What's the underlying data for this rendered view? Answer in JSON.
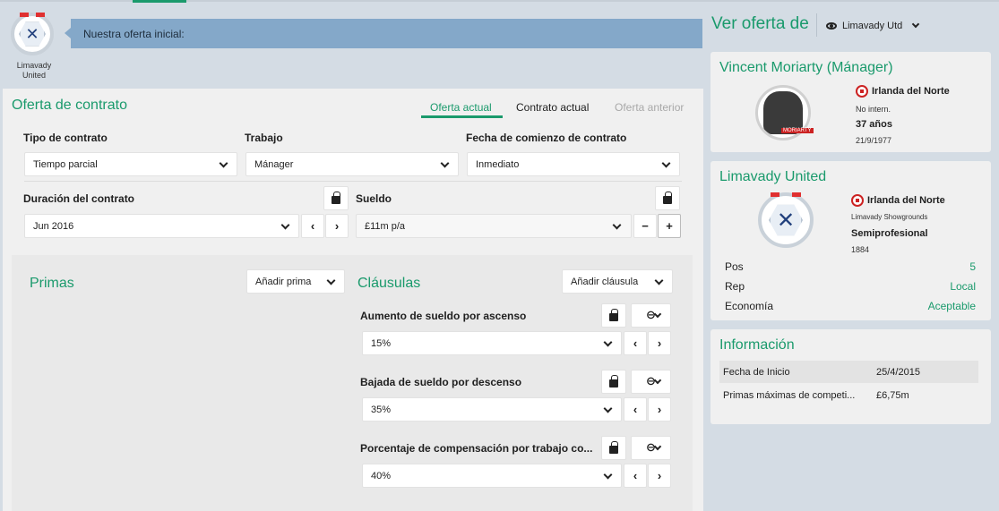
{
  "club_badge": {
    "name_line1": "Limavady",
    "name_line2": "United"
  },
  "message": {
    "text": "Nuestra oferta inicial:"
  },
  "offer": {
    "title": "Oferta de contrato",
    "tabs": [
      "Oferta actual",
      "Contrato actual",
      "Oferta anterior"
    ],
    "fields": {
      "contract_type": {
        "label": "Tipo de contrato",
        "value": "Tiempo parcial"
      },
      "job": {
        "label": "Trabajo",
        "value": "Mánager"
      },
      "start_date": {
        "label": "Fecha de comienzo de contrato",
        "value": "Inmediato"
      },
      "duration": {
        "label": "Duración del contrato",
        "value": "Jun 2016"
      },
      "salary": {
        "label": "Sueldo",
        "value": "£11m p/a"
      }
    },
    "bonuses": {
      "title": "Primas",
      "add_label": "Añadir prima"
    },
    "clauses": {
      "title": "Cláusulas",
      "add_label": "Añadir cláusula",
      "items": [
        {
          "label": "Aumento de sueldo por ascenso",
          "value": "15%"
        },
        {
          "label": "Bajada de sueldo por descenso",
          "value": "35%"
        },
        {
          "label": "Porcentaje de compensación por trabajo co...",
          "value": "40%"
        }
      ]
    }
  },
  "view_offer": {
    "title": "Ver oferta de",
    "selected": "Limavady Utd"
  },
  "manager": {
    "name": "Vincent Moriarty (Mánager)",
    "nation": "Irlanda del Norte",
    "caps": "No intern.",
    "age": "37 años",
    "dob": "21/9/1977",
    "portrait_caption": "MORIARTY"
  },
  "club": {
    "name": "Limavady United",
    "nation": "Irlanda del Norte",
    "stadium": "Limavady Showgrounds",
    "status": "Semiprofesional",
    "founded": "1884",
    "stats": [
      {
        "label": "Pos",
        "value": "5"
      },
      {
        "label": "Rep",
        "value": "Local"
      },
      {
        "label": "Economía",
        "value": "Aceptable"
      }
    ]
  },
  "info": {
    "title": "Información",
    "rows": [
      {
        "label": "Fecha de Inicio",
        "value": "25/4/2015"
      },
      {
        "label": "Primas máximas de competi...",
        "value": "£6,75m"
      }
    ]
  },
  "colors": {
    "accent": "#1a9a6c",
    "message_bg": "#84a8c9",
    "page_bg": "#d4dce4"
  }
}
